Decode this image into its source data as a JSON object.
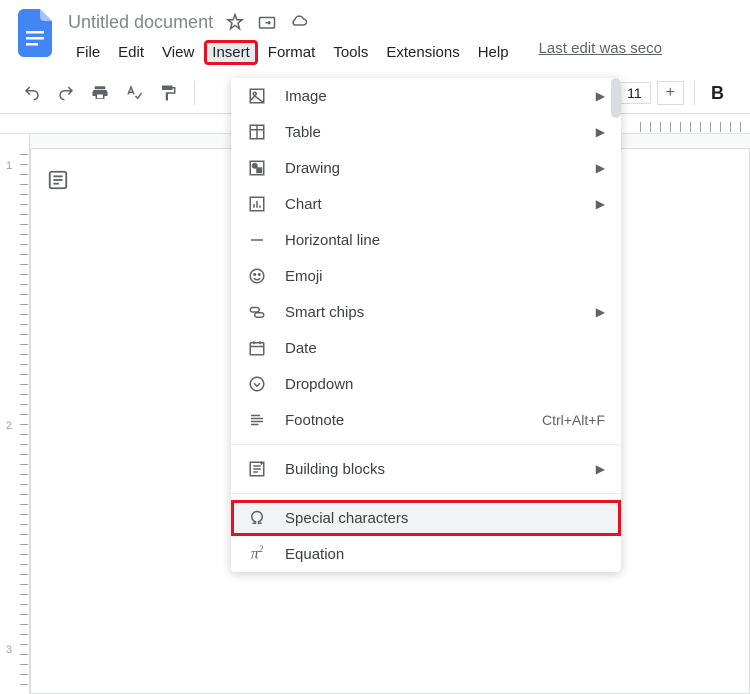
{
  "doc": {
    "title": "Untitled document",
    "last_edit": "Last edit was seco"
  },
  "menubar": {
    "file": "File",
    "edit": "Edit",
    "view": "View",
    "insert": "Insert",
    "format": "Format",
    "tools": "Tools",
    "extensions": "Extensions",
    "help": "Help"
  },
  "toolbar": {
    "font_size": "11",
    "plus": "+",
    "bold": "B"
  },
  "insert_menu": {
    "image": "Image",
    "table": "Table",
    "drawing": "Drawing",
    "chart": "Chart",
    "horizontal_line": "Horizontal line",
    "emoji": "Emoji",
    "smart_chips": "Smart chips",
    "date": "Date",
    "dropdown": "Dropdown",
    "footnote": "Footnote",
    "footnote_shortcut": "Ctrl+Alt+F",
    "building_blocks": "Building blocks",
    "special_characters": "Special characters",
    "equation": "Equation"
  },
  "ruler": {
    "n1": "1",
    "n2": "2",
    "n3": "3"
  }
}
